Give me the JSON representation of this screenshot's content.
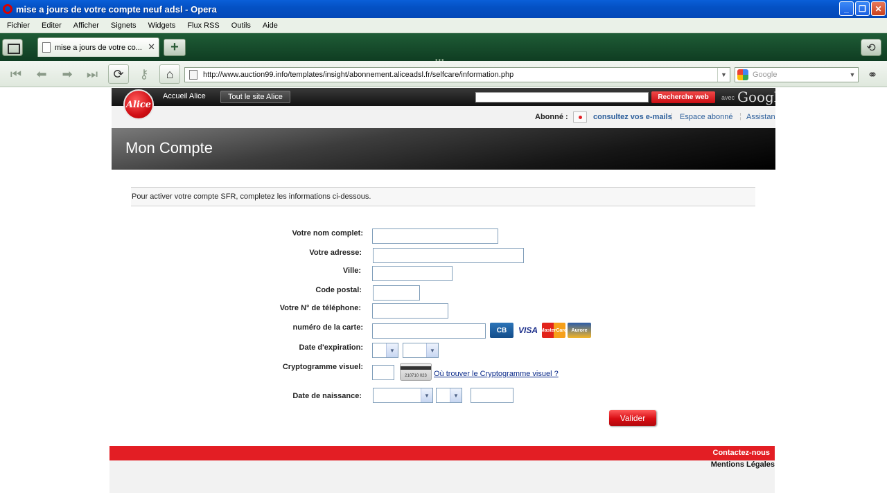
{
  "window": {
    "title": "mise a jours de votre compte neuf adsl - Opera",
    "buttons": {
      "minimize": "_",
      "maximize": "❐",
      "close": "✕"
    }
  },
  "menu": [
    "Fichier",
    "Editer",
    "Afficher",
    "Signets",
    "Widgets",
    "Flux RSS",
    "Outils",
    "Aide"
  ],
  "tabs": {
    "active_label": "mise a jours de votre co...",
    "close_glyph": "✕",
    "new_tab_glyph": "+"
  },
  "address": {
    "url": "http://www.auction99.info/templates/insight/abonnement.aliceadsl.fr/selfcare/information.php",
    "search_placeholder": "Google"
  },
  "site": {
    "logo_text": "Alice",
    "nav_home": "Accueil Alice",
    "nav_all": "Tout le site Alice",
    "search_button": "Recherche web",
    "avec": "avec",
    "google": "Google",
    "abonne_label": "Abonné :",
    "links": {
      "emails": "consultez vos e-mails",
      "espace": "Espace abonné",
      "assistance": "Assistan"
    },
    "banner_title": "Mon Compte",
    "intro": "Pour activer votre compte SFR, completez les informations ci-dessous."
  },
  "form": {
    "nom_label": "Votre nom complet:",
    "adresse_label": "Votre adresse:",
    "ville_label": "Ville:",
    "cp_label": "Code postal:",
    "tel_label": "Votre N° de téléphone:",
    "carte_label": "numéro de la carte:",
    "expiration_label": "Date d'expiration:",
    "crypto_label": "Cryptogramme visuel:",
    "naissance_label": "Date de naissance:",
    "crypto_link": "Où trouver le Cryptogramme visuel ?",
    "crypto_card_digits": "210710 023",
    "submit": "Valider",
    "cards": {
      "cb": "CB",
      "visa": "VISA",
      "mastercard": "MasterCard",
      "aurore": "Aurore"
    }
  },
  "footer": {
    "contact": "Contactez-nous",
    "mentions": "Mentions Légales"
  },
  "colors": {
    "sfr_red": "#e31e24",
    "titlebar_blue": "#0451c4",
    "tabbar_green": "#1f5c36"
  }
}
